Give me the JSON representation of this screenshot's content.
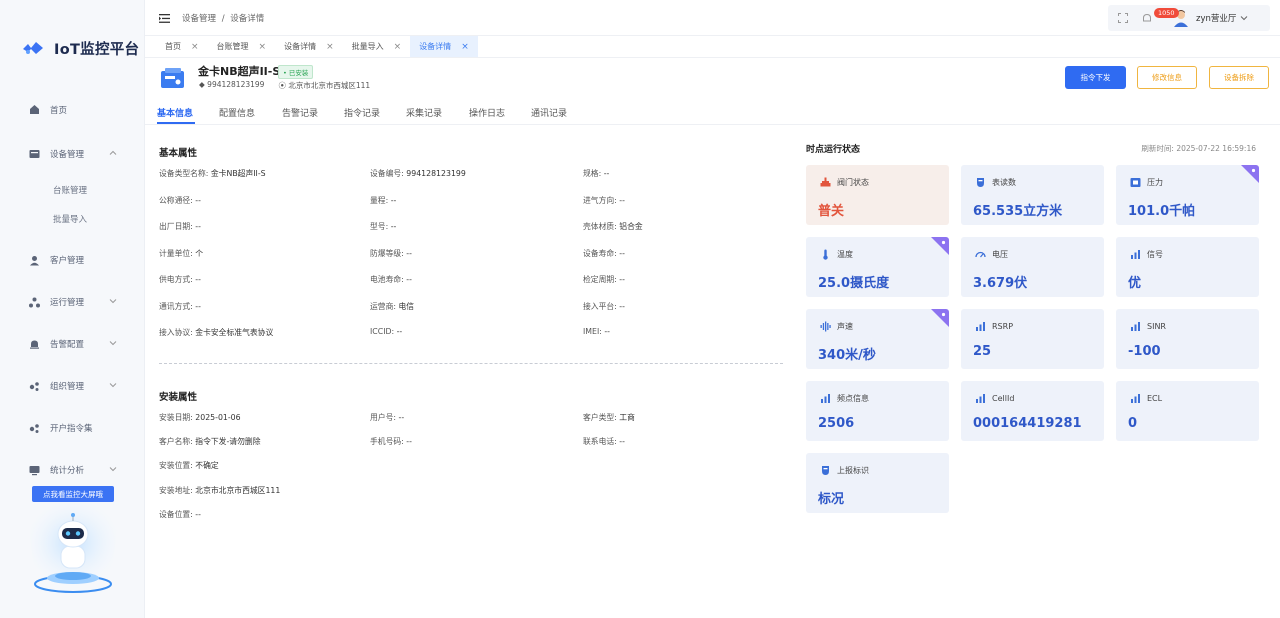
{
  "app": {
    "title": "IoT监控平台"
  },
  "sidebar": {
    "items": [
      {
        "label": "首页",
        "icon": "home-icon"
      },
      {
        "label": "设备管理",
        "icon": "device-icon",
        "expanded": true,
        "children": [
          {
            "label": "台账管理"
          },
          {
            "label": "批量导入"
          }
        ]
      },
      {
        "label": "客户管理",
        "icon": "user-icon"
      },
      {
        "label": "运行管理",
        "icon": "network-icon"
      },
      {
        "label": "告警配置",
        "icon": "bell-icon"
      },
      {
        "label": "组织管理",
        "icon": "org-icon"
      },
      {
        "label": "开户指令集",
        "icon": "org-icon"
      },
      {
        "label": "统计分析",
        "icon": "monitor-icon"
      }
    ],
    "promo_label": "点我看监控大屏哦"
  },
  "header": {
    "breadcrumb": [
      "设备管理",
      "设备详情"
    ],
    "breadcrumb_sep": "/",
    "notification_count": "1050",
    "user_name": "zyn营业厅"
  },
  "tabs": [
    {
      "label": "首页"
    },
    {
      "label": "台账管理"
    },
    {
      "label": "设备详情"
    },
    {
      "label": "批量导入"
    },
    {
      "label": "设备详情",
      "active": true
    }
  ],
  "device": {
    "name": "金卡NB超声II-S",
    "status": "• 已安装",
    "serial": "994128123199",
    "location": "北京市北京市西城区111",
    "actions": {
      "command": "指令下发",
      "edit": "修改信息",
      "delete": "设备拆除"
    }
  },
  "detail_tabs": [
    "基本信息",
    "配置信息",
    "告警记录",
    "指令记录",
    "采集记录",
    "操作日志",
    "通讯记录"
  ],
  "basic": {
    "title": "基本属性",
    "rows": [
      [
        {
          "k": "设备类型名称:",
          "v": "金卡NB超声II-S"
        },
        {
          "k": "设备编号:",
          "v": "994128123199"
        },
        {
          "k": "规格:",
          "v": "--"
        }
      ],
      [
        {
          "k": "公称通径:",
          "v": "--"
        },
        {
          "k": "量程:",
          "v": "--"
        },
        {
          "k": "进气方向:",
          "v": "--"
        }
      ],
      [
        {
          "k": "出厂日期:",
          "v": "--"
        },
        {
          "k": "型号:",
          "v": "--"
        },
        {
          "k": "壳体材质:",
          "v": "铝合金"
        }
      ],
      [
        {
          "k": "计量单位:",
          "v": "个"
        },
        {
          "k": "防爆等级:",
          "v": "--"
        },
        {
          "k": "设备寿命:",
          "v": "--"
        }
      ],
      [
        {
          "k": "供电方式:",
          "v": "--"
        },
        {
          "k": "电池寿命:",
          "v": "--"
        },
        {
          "k": "检定周期:",
          "v": "--"
        }
      ],
      [
        {
          "k": "通讯方式:",
          "v": "--"
        },
        {
          "k": "运营商:",
          "v": "电信"
        },
        {
          "k": "接入平台:",
          "v": "--"
        }
      ],
      [
        {
          "k": "接入协议:",
          "v": "金卡安全标准气表协议"
        },
        {
          "k": "ICCID:",
          "v": "--"
        },
        {
          "k": "IMEI:",
          "v": "--"
        }
      ]
    ]
  },
  "install": {
    "title": "安装属性",
    "rows": [
      [
        {
          "k": "安装日期:",
          "v": "2025-01-06"
        },
        {
          "k": "用户号:",
          "v": "--"
        },
        {
          "k": "客户类型:",
          "v": "工商"
        }
      ],
      [
        {
          "k": "客户名称:",
          "v": "指令下发-请勿删除"
        },
        {
          "k": "手机号码:",
          "v": "--"
        },
        {
          "k": "联系电话:",
          "v": "--"
        }
      ],
      [
        {
          "k": "安装位置:",
          "v": "不确定"
        }
      ],
      [
        {
          "k": "安装地址:",
          "v": "北京市北京市西城区111"
        }
      ],
      [
        {
          "k": "设备位置:",
          "v": "--"
        }
      ]
    ]
  },
  "status_panel": {
    "title": "时点运行状态",
    "refresh_time": "刷新时间: 2025-07-22 16:59:16",
    "cards": [
      {
        "label": "阀门状态",
        "value": "普关",
        "icon": "valve-icon",
        "warm": true,
        "corner": false
      },
      {
        "label": "表读数",
        "value": "65.535立方米",
        "icon": "meter-icon",
        "warm": false,
        "corner": false
      },
      {
        "label": "压力",
        "value": "101.0千帕",
        "icon": "pressure-icon",
        "warm": false,
        "corner": true
      },
      {
        "label": "温度",
        "value": "25.0摄氏度",
        "icon": "thermometer-icon",
        "warm": false,
        "corner": true
      },
      {
        "label": "电压",
        "value": "3.679伏",
        "icon": "gauge-icon",
        "warm": false,
        "corner": false
      },
      {
        "label": "信号",
        "value": "优",
        "icon": "signal-icon",
        "warm": false,
        "corner": false
      },
      {
        "label": "声速",
        "value": "340米/秒",
        "icon": "sound-wave-icon",
        "warm": false,
        "corner": true
      },
      {
        "label": "RSRP",
        "value": "25",
        "icon": "signal-icon",
        "warm": false,
        "corner": false
      },
      {
        "label": "SINR",
        "value": "-100",
        "icon": "signal-icon",
        "warm": false,
        "corner": false
      },
      {
        "label": "频点信息",
        "value": "2506",
        "icon": "signal-icon",
        "warm": false,
        "corner": false
      },
      {
        "label": "CellId",
        "value": "000164419281",
        "icon": "signal-icon",
        "warm": false,
        "corner": false
      },
      {
        "label": "ECL",
        "value": "0",
        "icon": "signal-icon",
        "warm": false,
        "corner": false
      },
      {
        "label": "上报标识",
        "value": "标况",
        "icon": "meter-icon",
        "warm": false,
        "corner": false
      }
    ]
  },
  "colors": {
    "primary": "#2f6bf2",
    "warning": "#ee9e18",
    "value_blue": "#2f58c8",
    "value_red": "#e2553d"
  }
}
